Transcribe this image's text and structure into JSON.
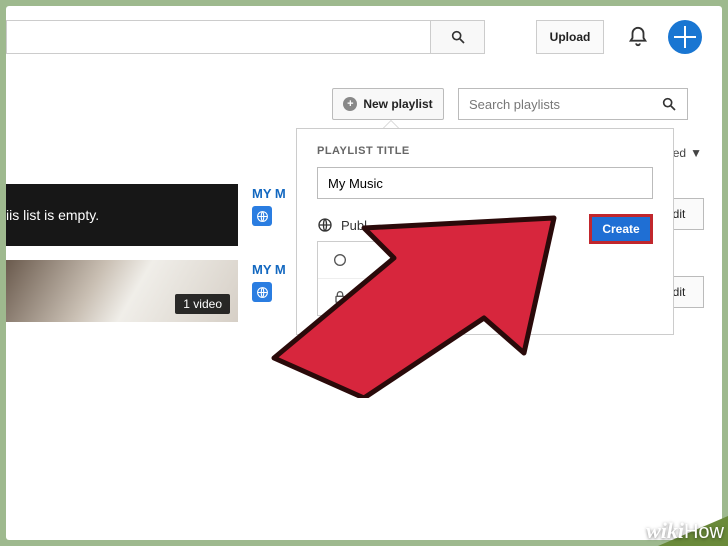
{
  "topbar": {
    "search_value": "",
    "upload_label": "Upload"
  },
  "controls": {
    "new_playlist_label": "New playlist",
    "search_playlists_placeholder": "Search playlists",
    "sort_label": "ated"
  },
  "popover": {
    "title_label": "PLAYLIST TITLE",
    "title_value": "My Music",
    "privacy_visible": "Publ",
    "privacy_options": [
      "",
      "Private"
    ],
    "create_label": "Create"
  },
  "playlists": [
    {
      "thumb_text": "iis list is empty.",
      "title": "MY M",
      "edit_label": "Edit"
    },
    {
      "thumb_text": "",
      "badge": "1 video",
      "title": "MY M",
      "edit_label": "Edit"
    }
  ],
  "edit_label": "Edit",
  "branding": {
    "wikihow": "wikiHow"
  }
}
